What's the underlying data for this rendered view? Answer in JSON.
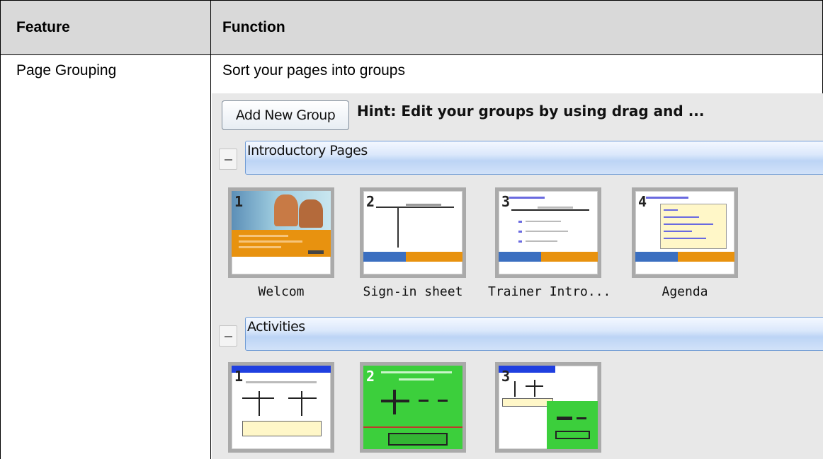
{
  "table": {
    "header": {
      "feature": "Feature",
      "function": "Function"
    },
    "row": {
      "feature": "Page Grouping",
      "function": "Sort your pages into groups"
    }
  },
  "app": {
    "add_group_button": "Add New Group",
    "hint": "Hint: Edit your groups by using drag and ...",
    "groups": [
      {
        "name": "Introductory Pages",
        "pages": [
          {
            "number": "1",
            "label": "Welcom"
          },
          {
            "number": "2",
            "label": "Sign-in sheet"
          },
          {
            "number": "3",
            "label": "Trainer Intro..."
          },
          {
            "number": "4",
            "label": "Agenda"
          }
        ]
      },
      {
        "name": "Activities",
        "pages": [
          {
            "number": "1",
            "label": ""
          },
          {
            "number": "2",
            "label": ""
          },
          {
            "number": "3",
            "label": ""
          }
        ]
      }
    ]
  },
  "colors": {
    "header_bg": "#d9d9d9",
    "panel_bg": "#e8e8e8",
    "group_bar": "#bcd4f5",
    "slide_orange": "#e8920f",
    "slide_blue": "#1f3fe0",
    "slide_green": "#3ccf3c"
  }
}
